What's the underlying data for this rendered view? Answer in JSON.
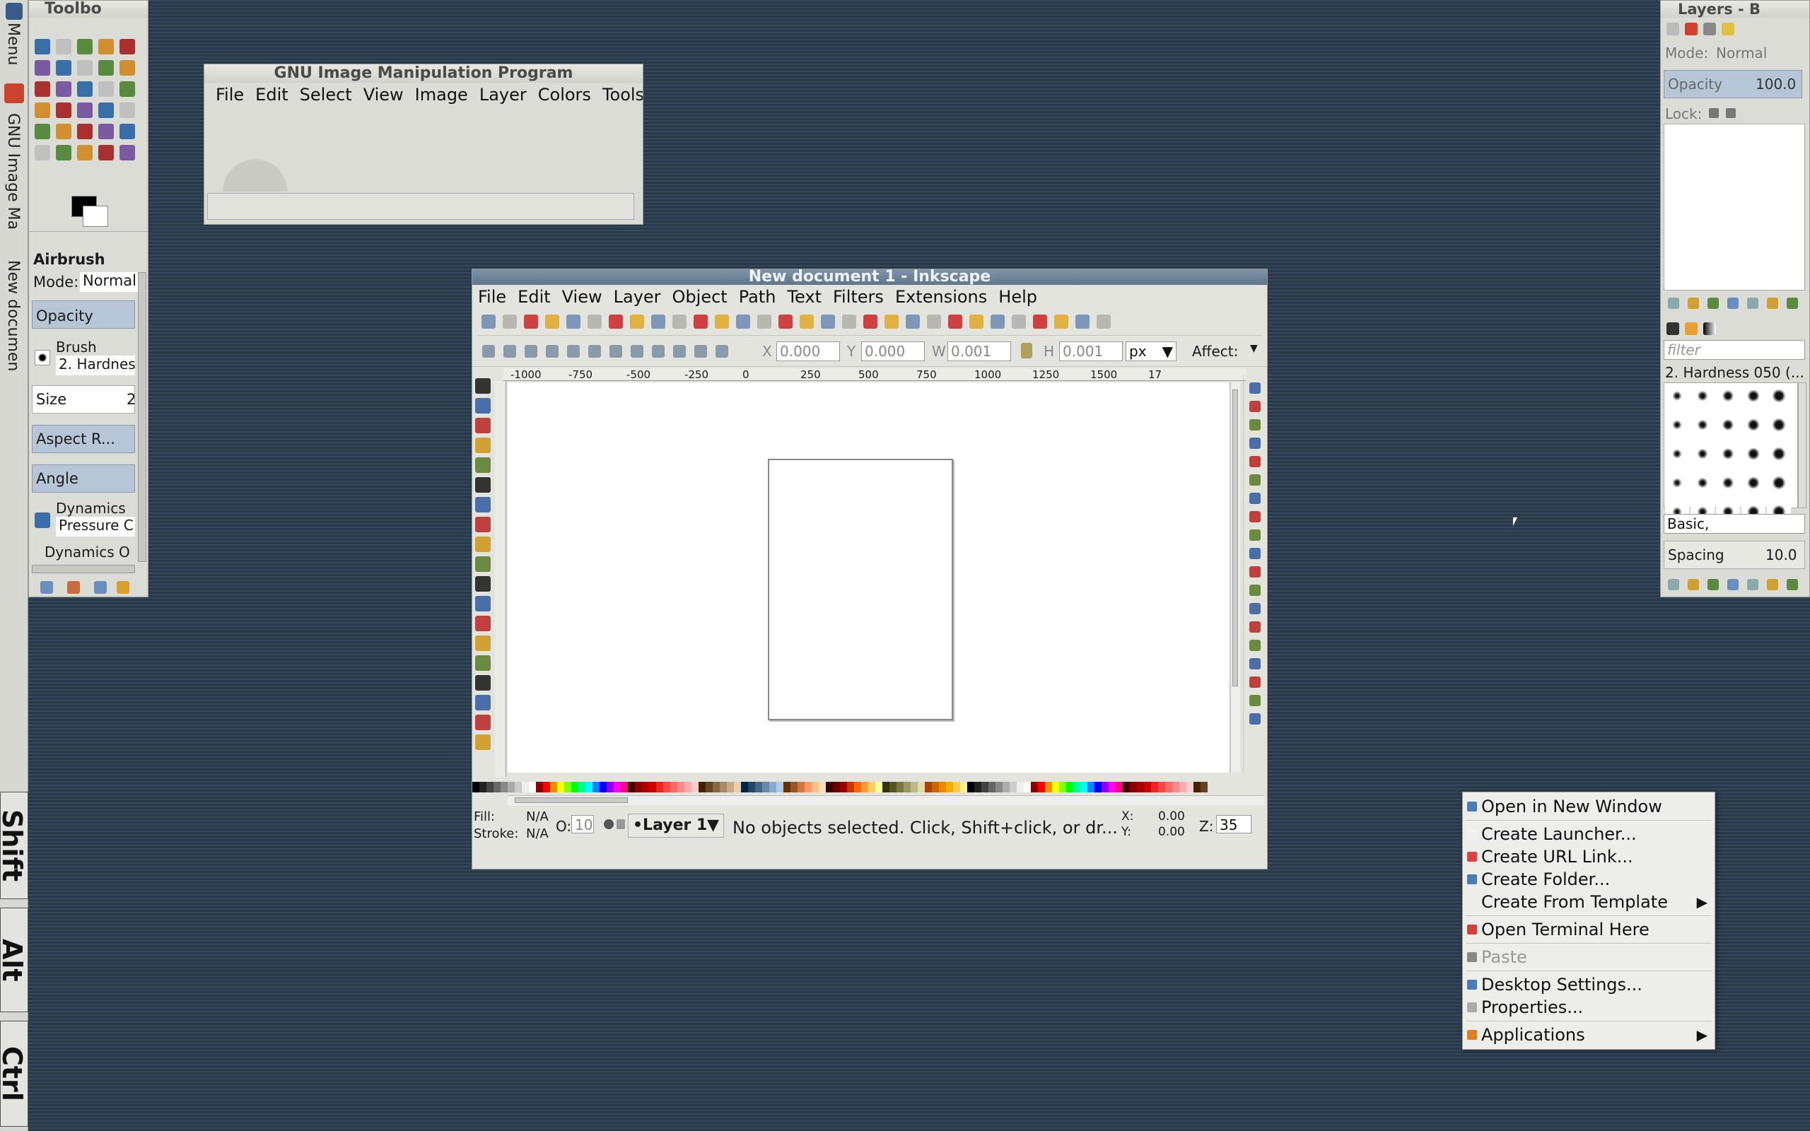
{
  "left_strip": {
    "menu_label": "Menu",
    "gimp_task": "GNU Image Ma",
    "inkscape_task": "New documen",
    "keys": [
      "Shift",
      "Alt",
      "Ctrl"
    ]
  },
  "toolbox": {
    "title": "Toolbo",
    "tool_name": "Airbrush",
    "mode_label": "Mode:",
    "mode_value": "Normal",
    "opacity_label": "Opacity",
    "brush_label": "Brush",
    "brush_value": "2. Hardnes",
    "size_label": "Size",
    "size_value": "2",
    "aspect_label": "Aspect R...",
    "angle_label": "Angle",
    "dynamics_label": "Dynamics",
    "dynamics_value": "Pressure C",
    "dynamics_options": "Dynamics O"
  },
  "gimp": {
    "title": "GNU Image Manipulation Program",
    "menu": [
      "File",
      "Edit",
      "Select",
      "View",
      "Image",
      "Layer",
      "Colors",
      "Tools"
    ]
  },
  "inkscape": {
    "title": "New document 1 - Inkscape",
    "menu": [
      "File",
      "Edit",
      "View",
      "Layer",
      "Object",
      "Path",
      "Text",
      "Filters",
      "Extensions",
      "Help"
    ],
    "x_label": "X",
    "x_value": "0.000",
    "y_label": "Y",
    "y_value": "0.000",
    "w_label": "W",
    "w_value": "0.001",
    "h_label": "H",
    "h_value": "0.001",
    "unit": "px",
    "affect_label": "Affect:",
    "ruler_ticks": [
      "-1000",
      "-750",
      "-500",
      "-250",
      "0",
      "250",
      "500",
      "750",
      "1000",
      "1250",
      "1500",
      "17"
    ],
    "fill_label": "Fill:",
    "fill_value": "N/A",
    "stroke_label": "Stroke:",
    "stroke_value": "N/A",
    "opacity_label": "O:",
    "opacity_value": "10",
    "layer_value": "•Layer 1",
    "status": "No objects selected. Click, Shift+click, or dr...",
    "cx_label": "X:",
    "cx_value": "0.00",
    "cy_label": "Y:",
    "cy_value": "0.00",
    "zoom_label": "Z:",
    "zoom_value": "35"
  },
  "layers": {
    "title": "Layers - B",
    "mode_label": "Mode:",
    "mode_value": "Normal",
    "opacity_label": "Opacity",
    "opacity_value": "100.0",
    "lock_label": "Lock:",
    "filter_placeholder": "filter",
    "brush_name": "2. Hardness 050 (...",
    "brush_set": "Basic,",
    "spacing_label": "Spacing",
    "spacing_value": "10.0"
  },
  "context_menu": {
    "items": [
      {
        "label": "Open in New Window",
        "color": "#4a7bb5"
      },
      {
        "label": "Create Launcher...",
        "color": "#f0f0f0"
      },
      {
        "label": "Create URL Link...",
        "color": "#e04040"
      },
      {
        "label": "Create Folder...",
        "color": "#4a7bb5"
      },
      {
        "label": "Create From Template",
        "color": "none"
      },
      {
        "label": "Open Terminal Here",
        "color": "#d04040"
      },
      {
        "label": "Paste",
        "color": "#888888"
      },
      {
        "label": "Desktop Settings...",
        "color": "#4a7bb5"
      },
      {
        "label": "Properties...",
        "color": "#aaaaaa"
      },
      {
        "label": "Applications",
        "color": "#e08020"
      }
    ]
  }
}
